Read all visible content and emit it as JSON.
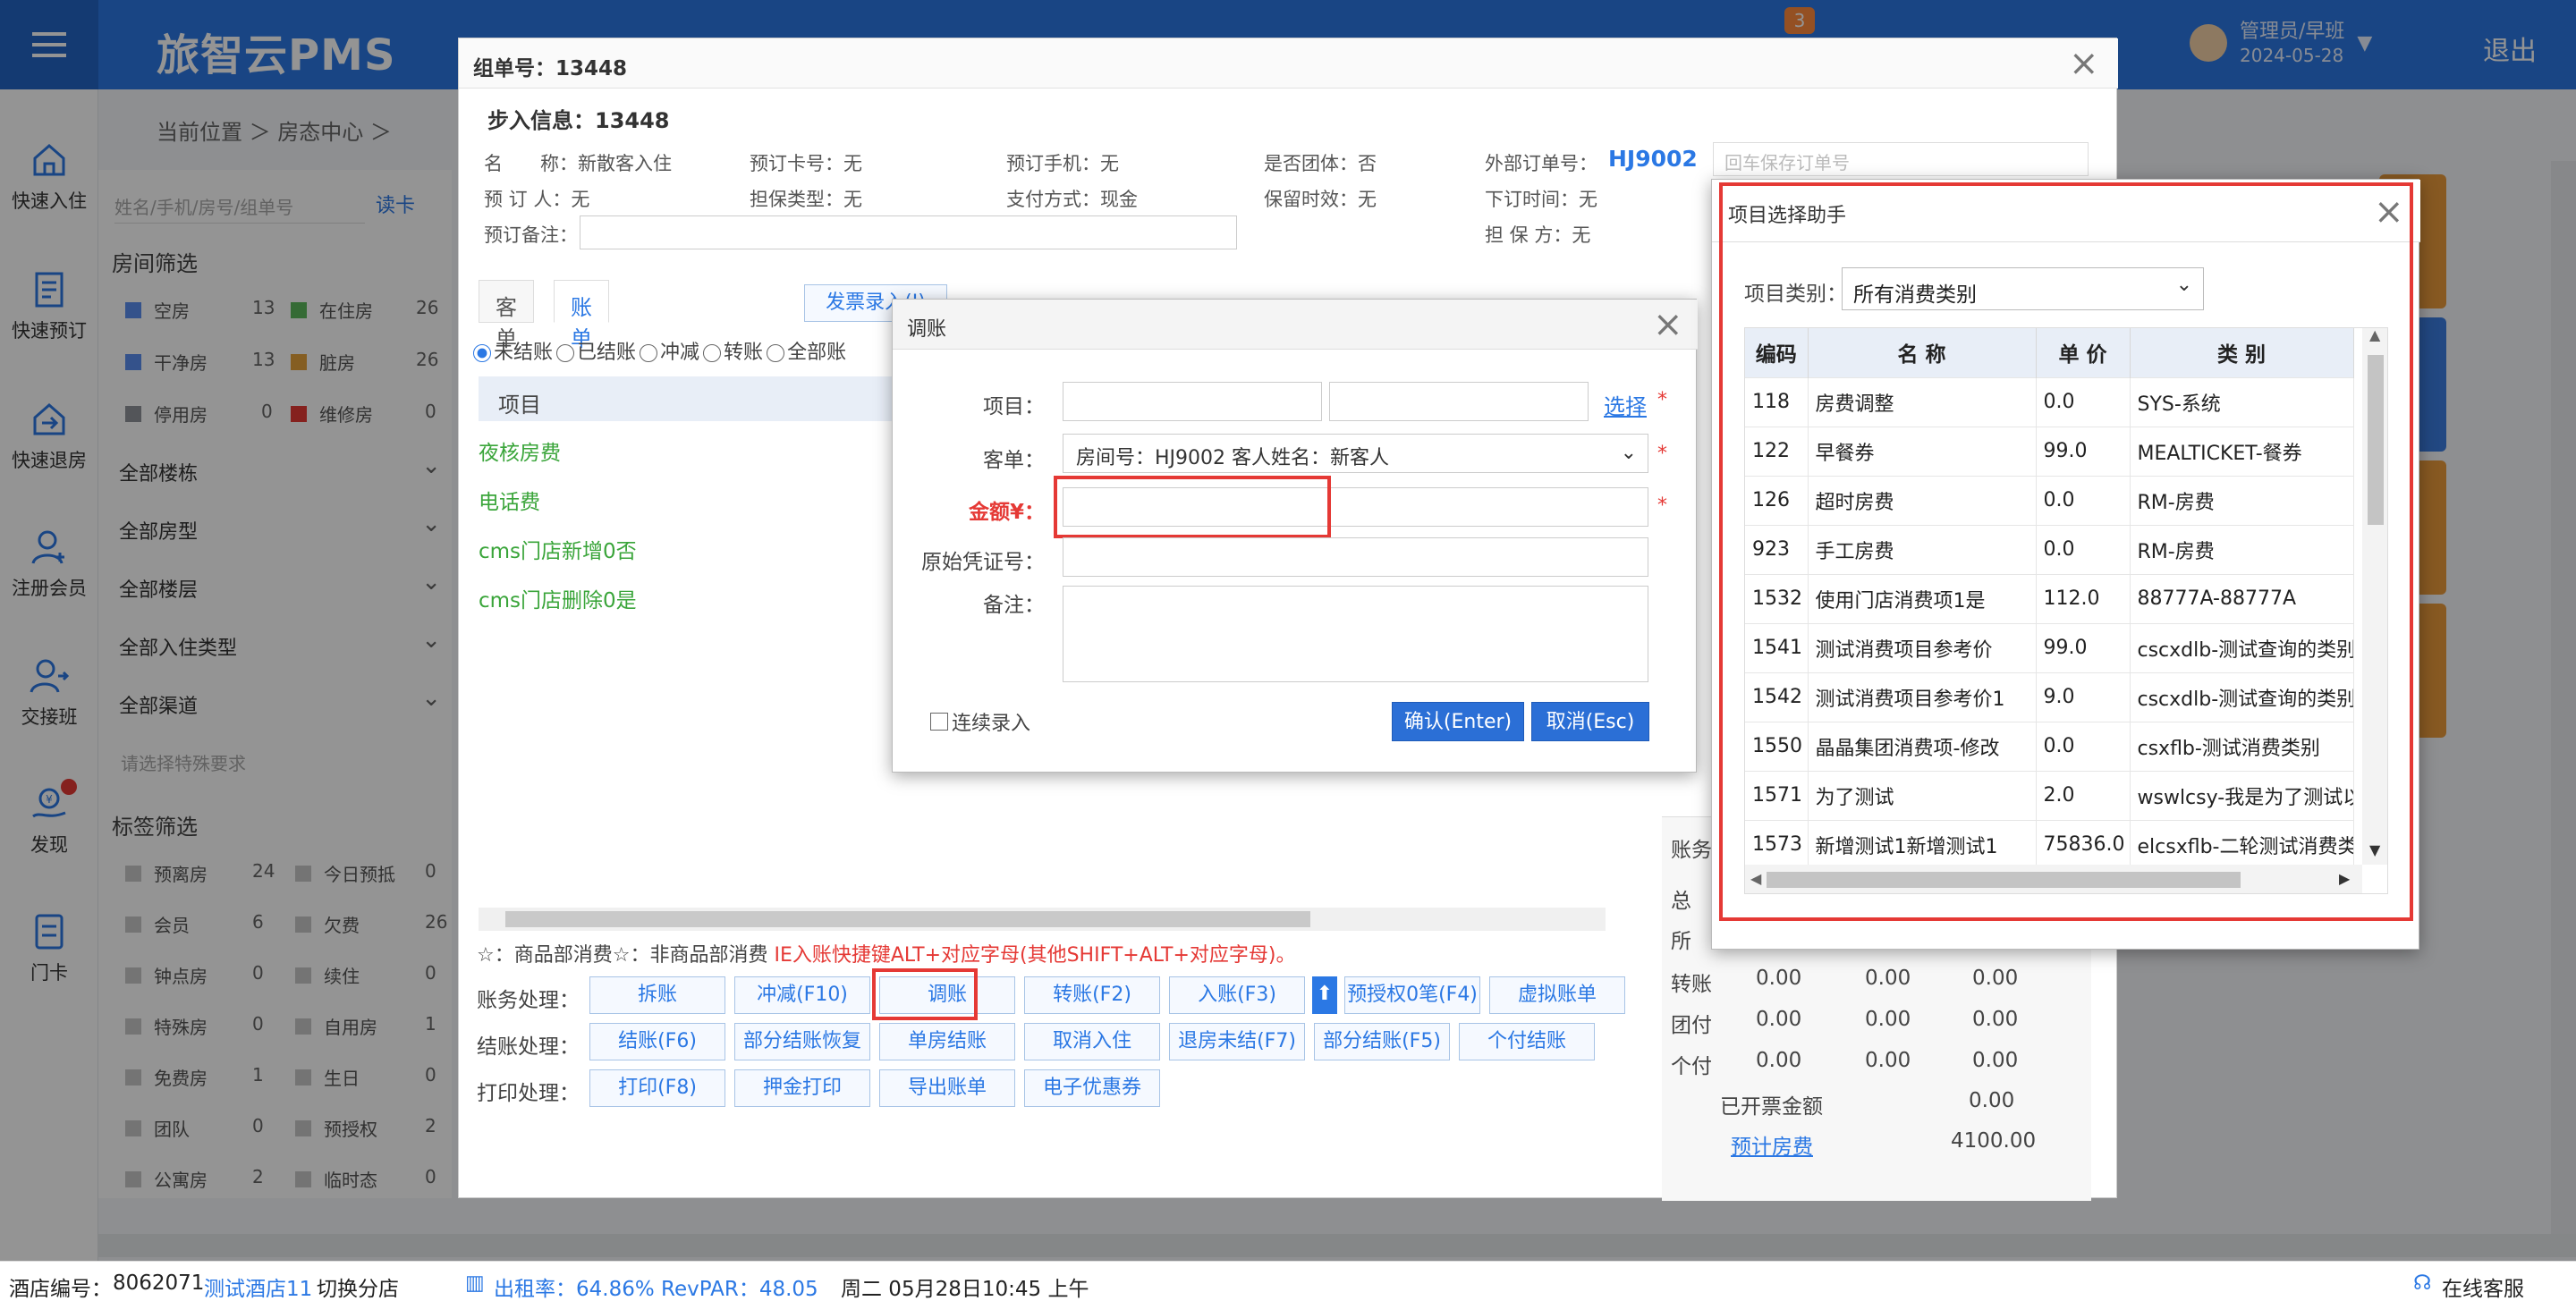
{
  "app": {
    "brand": "旅智云PMS",
    "user_name": "管理员/早班",
    "user_date": "2024-05-28",
    "logout": "退出",
    "notif_count": "3",
    "breadcrumb": "当前位置 ＞ 房态中心 ＞"
  },
  "sidenav": [
    {
      "label": "快速入住",
      "icon": "home-icon"
    },
    {
      "label": "快速预订",
      "icon": "booking-icon"
    },
    {
      "label": "快速退房",
      "icon": "checkout-icon"
    },
    {
      "label": "注册会员",
      "icon": "user-add-icon"
    },
    {
      "label": "交接班",
      "icon": "shift-icon"
    },
    {
      "label": "发现",
      "icon": "discover-icon"
    },
    {
      "label": "门卡",
      "icon": "card-icon"
    }
  ],
  "left_panel": {
    "search_placeholder": "姓名/手机/房号/组单号",
    "read_card": "读卡",
    "room_filter": "房间筛选",
    "room_status": [
      {
        "label": "空房",
        "count": "13",
        "color": "#5b8def"
      },
      {
        "label": "在住房",
        "count": "26",
        "color": "#5cb85c"
      },
      {
        "label": "干净房",
        "count": "13",
        "color": "#5b8def"
      },
      {
        "label": "脏房",
        "count": "26",
        "color": "#e6a23c"
      },
      {
        "label": "停用房",
        "count": "0",
        "color": "#909399"
      },
      {
        "label": "维修房",
        "count": "0",
        "color": "#e53935"
      }
    ],
    "dropdowns": [
      "全部楼栋",
      "全部房型",
      "全部楼层",
      "全部入住类型",
      "全部渠道"
    ],
    "special_req": "请选择特殊要求",
    "tag_filter": "标签筛选",
    "tags": [
      {
        "label": "预离房",
        "count": "24"
      },
      {
        "label": "今日预抵",
        "count": "0"
      },
      {
        "label": "会员",
        "count": "6"
      },
      {
        "label": "欠费",
        "count": "26"
      },
      {
        "label": "钟点房",
        "count": "0"
      },
      {
        "label": "续住",
        "count": "0"
      },
      {
        "label": "特殊房",
        "count": "0"
      },
      {
        "label": "自用房",
        "count": "1"
      },
      {
        "label": "免费房",
        "count": "1"
      },
      {
        "label": "生日",
        "count": "0"
      },
      {
        "label": "团队",
        "count": "0"
      },
      {
        "label": "预授权",
        "count": "2"
      },
      {
        "label": "公寓房",
        "count": "2"
      },
      {
        "label": "临时态",
        "count": "0"
      }
    ]
  },
  "group_dialog": {
    "title": "组单号：13448",
    "info_title": "步入信息：13448",
    "fields": {
      "name": "名　　称：新散客入住",
      "card_no": "预订卡号：无",
      "phone": "预订手机：无",
      "is_group": "是否团体：否",
      "ext_label": "外部订单号：",
      "ext_value": "HJ9002",
      "ext_placeholder": "回车保存订单号",
      "booker": "预 订 人：无",
      "guarantee": "担保类型：无",
      "payment": "支付方式：现金",
      "hold": "保留时效：无",
      "order_time": "下订时间：无",
      "remark": "预订备注：",
      "guarantor": "担 保 方：无"
    },
    "tabs": [
      "客单",
      "账单"
    ],
    "top_buttons": [
      "发票录入(I)"
    ],
    "radios": [
      "未结账",
      "已结账",
      "冲减",
      "转账",
      "全部账"
    ],
    "table_head": "项目",
    "rows": [
      "夜核房费",
      "电话费",
      "cms门店新增0否",
      "cms门店删除0是"
    ],
    "goods_line_a": "☆：商品部消费",
    "goods_line_b": "☆：非商品部消费",
    "goods_line_red": "IE入账快捷键ALT+对应字母(其他SHIFT+ALT+对应字母)。",
    "op_rows": [
      {
        "label": "账务处理：",
        "buttons": [
          "拆账",
          "冲减(F10)",
          "调账",
          "转账(F2)",
          "入账(F3)",
          "预授权0笔(F4)",
          "虚拟账单"
        ]
      },
      {
        "label": "结账处理：",
        "buttons": [
          "结账(F6)",
          "部分结账恢复",
          "单房结账",
          "取消入住",
          "退房未结(F7)",
          "部分结账(F5)",
          "个付结账"
        ]
      },
      {
        "label": "打印处理：",
        "buttons": [
          "打印(F8)",
          "押金打印",
          "导出账单",
          "电子优惠券"
        ]
      }
    ],
    "acct_title": "账务",
    "summary": {
      "total_label": "总",
      "all_label": "所",
      "rows": [
        {
          "label": "转账",
          "a": "0.00",
          "b": "0.00",
          "c": "0.00"
        },
        {
          "label": "团付",
          "a": "0.00",
          "b": "0.00",
          "c": "0.00"
        },
        {
          "label": "个付",
          "a": "0.00",
          "b": "0.00",
          "c": "0.00"
        }
      ],
      "invoiced_label": "已开票金额",
      "invoiced_value": "0.00",
      "forecast_label": "预计房费",
      "forecast_value": "4100.00"
    }
  },
  "adjust_dialog": {
    "title": "调账",
    "item_label": "项目：",
    "choose": "选择",
    "guest_label": "客单：",
    "guest_value": "房间号：HJ9002 客人姓名：新客人",
    "amount_label": "金额¥：",
    "voucher_label": "原始凭证号：",
    "remark_label": "备注：",
    "continuous": "连续录入",
    "confirm": "确认(Enter)",
    "cancel": "取消(Esc)"
  },
  "item_dialog": {
    "title": "项目选择助手",
    "category_label": "项目类别：",
    "category_value": "所有消费类别",
    "columns": [
      "编码",
      "名 称",
      "单 价",
      "类 别"
    ],
    "rows": [
      [
        "118",
        "房费调整",
        "0.0",
        "SYS-系统"
      ],
      [
        "122",
        "早餐券",
        "99.0",
        "MEALTICKET-餐券"
      ],
      [
        "126",
        "超时房费",
        "0.0",
        "RM-房费"
      ],
      [
        "923",
        "手工房费",
        "0.0",
        "RM-房费"
      ],
      [
        "1532",
        "使用门店消费项1是",
        "112.0",
        "88777A-88777A"
      ],
      [
        "1541",
        "测试消费项目参考价",
        "99.0",
        "cscxdlb-测试查询的类别"
      ],
      [
        "1542",
        "测试消费项目参考价1",
        "9.0",
        "cscxdlb-测试查询的类别"
      ],
      [
        "1550",
        "晶晶集团消费项-修改",
        "0.0",
        "csxflb-测试消费类别"
      ],
      [
        "1571",
        "为了测试",
        "2.0",
        "wswlcsy-我是为了测试以"
      ],
      [
        "1573",
        "新增测试1新增测试1",
        "75836.0",
        "elcsxflb-二轮测试消费类"
      ]
    ]
  },
  "statusbar": {
    "hotel_no_label": "酒店编号：",
    "hotel_no": "8062071",
    "hotel_name": "测试酒店11",
    "switch": "切换分店",
    "occupancy": "出租率：64.86% RevPAR：48.05",
    "datetime": "周二 05月28日10:45 上午",
    "service": "在线客服"
  }
}
